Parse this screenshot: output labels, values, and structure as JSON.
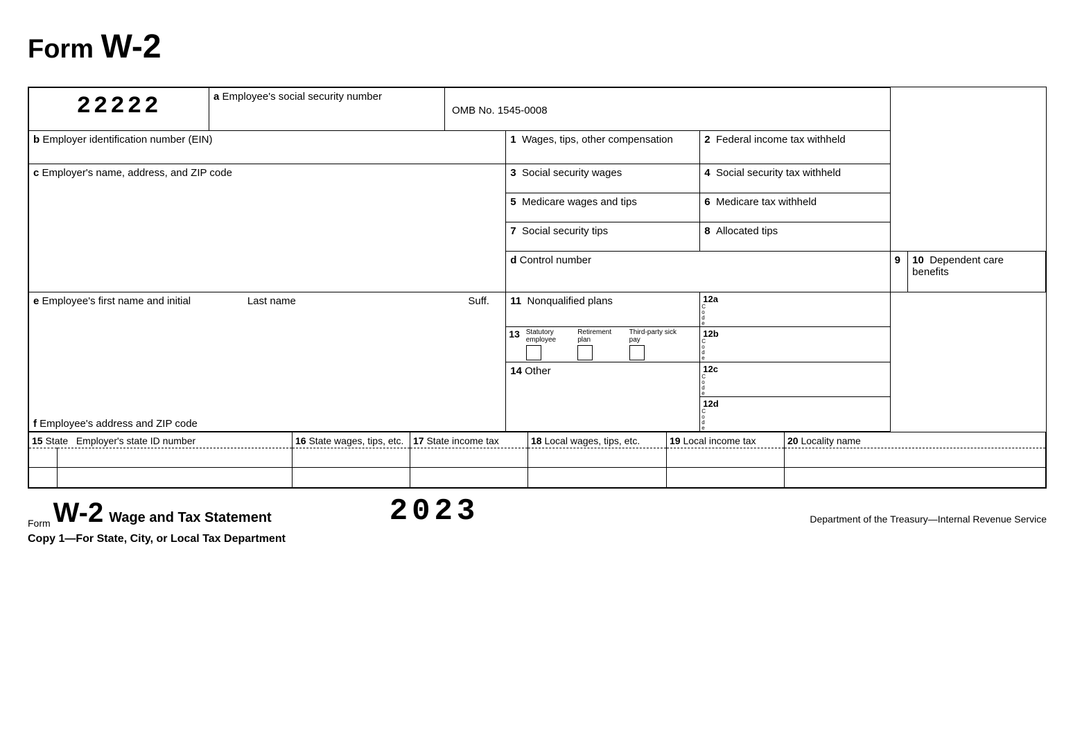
{
  "page_title_prefix": "Form ",
  "page_title_main": "W-2",
  "seg_number": "22222",
  "box_a_label": "Employee's social security number",
  "omb": "OMB No. 1545-0008",
  "box_b_label": "Employer identification number (EIN)",
  "box_c_label": "Employer's name, address, and ZIP code",
  "box_d_label": "Control number",
  "box_e_label": "Employee's first name and initial",
  "box_e_last": "Last name",
  "box_e_suff": "Suff.",
  "box_f_label": "Employee's address and ZIP code",
  "box1": "Wages, tips, other compensation",
  "box2": "Federal income tax withheld",
  "box3": "Social security wages",
  "box4": "Social security tax withheld",
  "box5": "Medicare wages and tips",
  "box6": "Medicare tax withheld",
  "box7": "Social security tips",
  "box8": "Allocated tips",
  "box9": "",
  "box10": "Dependent care benefits",
  "box11": "Nonqualified plans",
  "box12a": "12a",
  "box12b": "12b",
  "box12c": "12c",
  "box12d": "12d",
  "code_vert": "C\no\nd\ne",
  "box13_stat": "Statutory employee",
  "box13_ret": "Retirement plan",
  "box13_3p": "Third-party sick pay",
  "box14": "Other",
  "box15_state": "State",
  "box15_id": "Employer's state ID number",
  "box16": "State wages, tips, etc.",
  "box17": "State income tax",
  "box18": "Local wages, tips, etc.",
  "box19": "Local income tax",
  "box20": "Locality name",
  "footer_form": "Form",
  "footer_w2": "W-2",
  "footer_title": "Wage and Tax Statement",
  "footer_year": "2023",
  "footer_dept": "Department of the Treasury—Internal Revenue Service",
  "footer_copy": "Copy 1—For State, City, or Local Tax Department",
  "n1": "1",
  "n2": "2",
  "n3": "3",
  "n4": "4",
  "n5": "5",
  "n6": "6",
  "n7": "7",
  "n8": "8",
  "n9": "9",
  "n10": "10",
  "n11": "11",
  "n13": "13",
  "n14": "14",
  "n15": "15",
  "n16": "16",
  "n17": "17",
  "n18": "18",
  "n19": "19",
  "n20": "20",
  "letter_a": "a",
  "letter_b": "b",
  "letter_c": "c",
  "letter_d": "d",
  "letter_e": "e",
  "letter_f": "f"
}
